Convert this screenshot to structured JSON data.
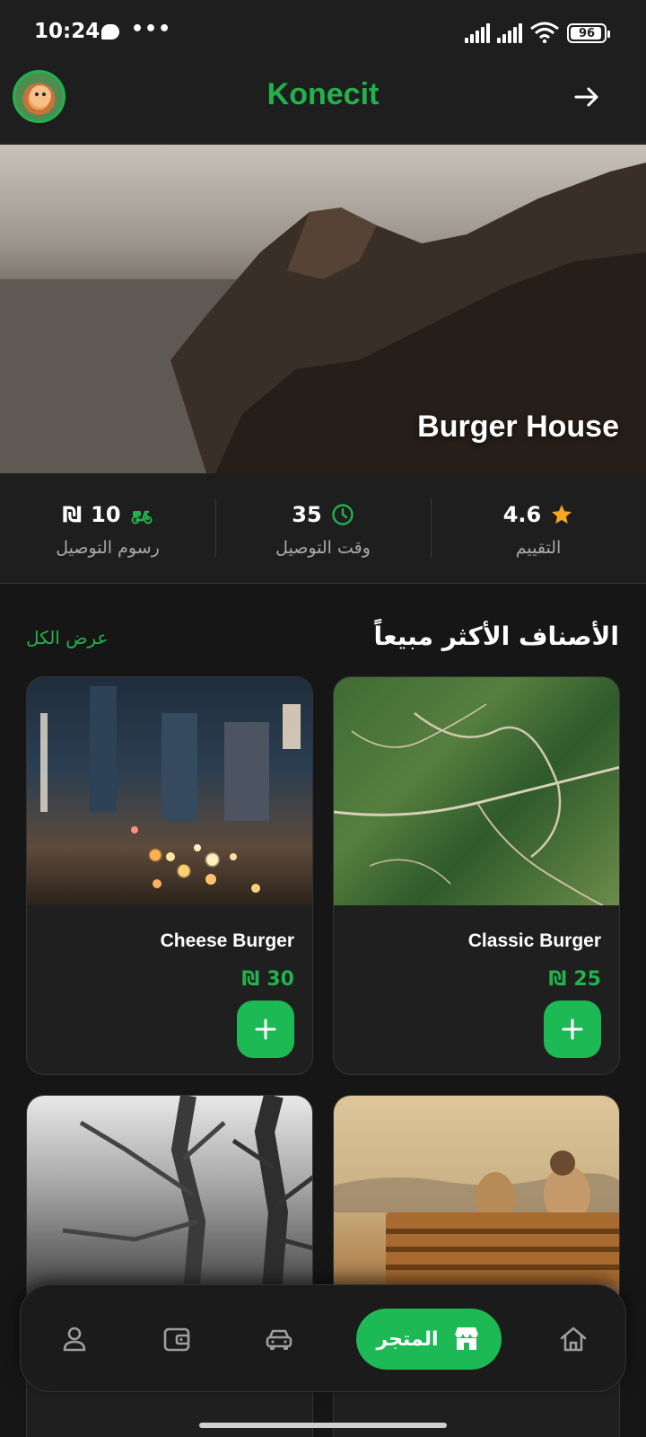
{
  "status_bar": {
    "time": "10:24",
    "dots": "•••",
    "battery": "96"
  },
  "header": {
    "title": "Konecit"
  },
  "hero": {
    "restaurant_name": "Burger House"
  },
  "stats": [
    {
      "value": "10",
      "currency": "₪",
      "label": "رسوم التوصيل",
      "icon": "scooter-icon"
    },
    {
      "value": "35",
      "label": "وقت التوصيل",
      "icon": "clock-icon"
    },
    {
      "value": "4.6",
      "label": "التقييم",
      "icon": "star-icon"
    }
  ],
  "section": {
    "title": "الأصناف الأكثر مبيعاً",
    "view_all": "عرض الكل"
  },
  "products": [
    {
      "name": "Classic Burger",
      "price": "25",
      "currency": "₪"
    },
    {
      "name": "Cheese Burger",
      "price": "30",
      "currency": "₪"
    }
  ],
  "bottom_nav": {
    "store_label": "المتجر"
  },
  "colors": {
    "accent": "#1db954",
    "brand": "#22b24c",
    "background": "#161616",
    "surface": "#1e1e1e"
  }
}
